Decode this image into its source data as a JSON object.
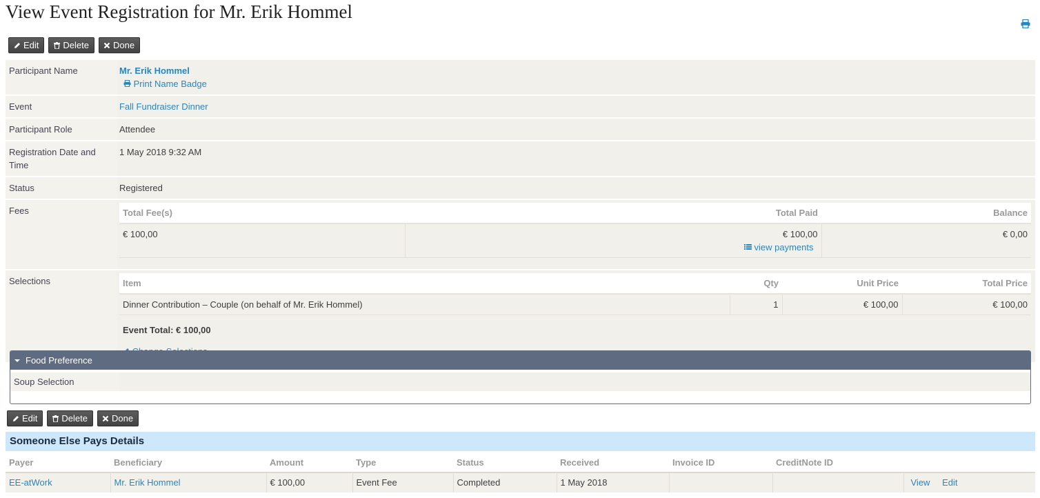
{
  "page": {
    "title": "View Event Registration for Mr. Erik Hommel"
  },
  "buttons": {
    "edit": "Edit",
    "delete": "Delete",
    "done": "Done"
  },
  "fields": {
    "participant_name_label": "Participant Name",
    "participant_name": "Mr. Erik Hommel",
    "print_badge": "Print Name Badge",
    "event_label": "Event",
    "event": "Fall Fundraiser Dinner",
    "role_label": "Participant Role",
    "role": "Attendee",
    "reg_date_label": "Registration Date and Time",
    "reg_date": "1 May 2018 9:32 AM",
    "status_label": "Status",
    "status": "Registered",
    "fees_label": "Fees",
    "selections_label": "Selections"
  },
  "fees": {
    "headers": [
      "Total Fee(s)",
      "Total Paid",
      "Balance"
    ],
    "total_fee": "€ 100,00",
    "total_paid": "€ 100,00",
    "balance": "€ 0,00",
    "view_payments": "view payments"
  },
  "selections": {
    "headers": [
      "Item",
      "Qty",
      "Unit Price",
      "Total Price"
    ],
    "item": "Dinner Contribution – Couple (on behalf of Mr. Erik Hommel)",
    "qty": "1",
    "unit_price": "€ 100,00",
    "total_price": "€ 100,00",
    "event_total": "Event Total: € 100,00",
    "change": "Change Selections"
  },
  "food": {
    "title": "Food Preference",
    "soup_label": "Soup Selection",
    "soup_value": ""
  },
  "someone_else": {
    "title": "Someone Else Pays Details",
    "headers": [
      "Payer",
      "Beneficiary",
      "Amount",
      "Type",
      "Status",
      "Received",
      "Invoice ID",
      "CreditNote ID",
      ""
    ],
    "row": {
      "payer": "EE-atWork",
      "beneficiary": "Mr. Erik Hommel",
      "amount": "€ 100,00",
      "type": "Event Fee",
      "status": "Completed",
      "received": "1 May 2018",
      "invoice": "",
      "creditnote": "",
      "view": "View",
      "edit": "Edit"
    }
  },
  "colors": {
    "link": "#2786c2",
    "panel_header": "#5f6b80",
    "section_header": "#cde8fb"
  }
}
